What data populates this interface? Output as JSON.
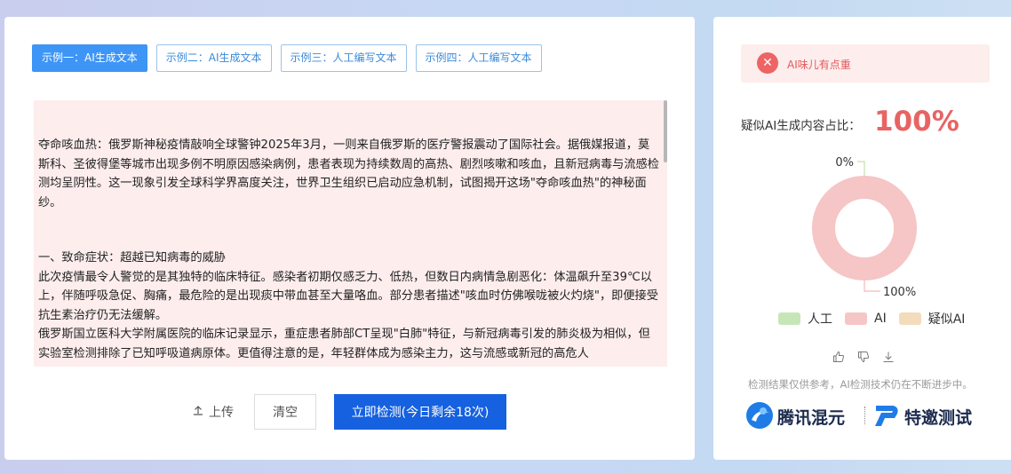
{
  "tabs": [
    {
      "label": "示例一：AI生成文本",
      "active": true
    },
    {
      "label": "示例二：AI生成文本",
      "active": false
    },
    {
      "label": "示例三：人工编写文本",
      "active": false
    },
    {
      "label": "示例四：人工编写文本",
      "active": false
    }
  ],
  "article": {
    "p1": "夺命咳血热：俄罗斯神秘疫情敲响全球警钟2025年3月，一则来自俄罗斯的医疗警报震动了国际社会。据俄媒报道，莫斯科、圣彼得堡等城市出现多例不明原因感染病例，患者表现为持续数周的高热、剧烈咳嗽和咳血，且新冠病毒与流感检测均呈阴性。这一现象引发全球科学界高度关注，世界卫生组织已启动应急机制，试图揭开这场\"夺命咳血热\"的神秘面纱。",
    "h1": "一、致命症状：超越已知病毒的威胁",
    "p2": "此次疫情最令人警觉的是其独特的临床特征。感染者初期仅感乏力、低热，但数日内病情急剧恶化：体温飙升至39℃以上，伴随呼吸急促、胸痛，最危险的是出现痰中带血甚至大量咯血。部分患者描述\"咳血时仿佛喉咙被火灼烧\"，即便接受抗生素治疗仍无法缓解。",
    "p3": "俄罗斯国立医科大学附属医院的临床记录显示，重症患者肺部CT呈现\"白肺\"特征，与新冠病毒引发的肺炎极为相似，但实验室检测排除了已知呼吸道病原体。更值得注意的是，年轻群体成为感染主力，这与流感或新冠的高危人"
  },
  "actions": {
    "upload_label": "上传",
    "clear_label": "清空",
    "detect_label": "立即检测(今日剩余18次)"
  },
  "result": {
    "alert_text": "AI味儿有点重",
    "ratio_label": "疑似AI生成内容占比：",
    "ratio_value": "100%"
  },
  "chart_data": {
    "type": "pie",
    "style": "donut",
    "categories": [
      "人工",
      "AI",
      "疑似AI"
    ],
    "values": [
      0,
      100,
      0
    ],
    "colors": [
      "#c7e6b8",
      "#f6c5c5",
      "#f3dcbc"
    ],
    "labels": [
      "0%",
      "100%"
    ]
  },
  "colors": {
    "primary": "#1561e0",
    "tab_active": "#3d95f6",
    "danger": "#e86464",
    "text_highlight_bg": "#fdeded"
  },
  "disclaimer": "检测结果仅供参考，AI检测技术仍在不断进步中。",
  "brands": {
    "brand1": "腾讯混元",
    "brand2": "特邀测试"
  }
}
